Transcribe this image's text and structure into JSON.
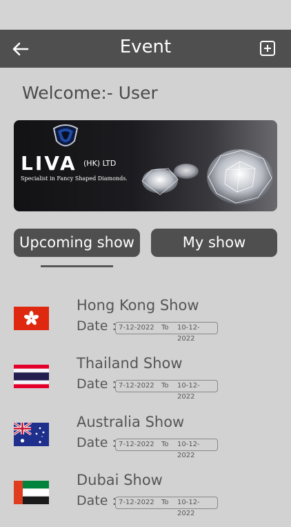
{
  "header": {
    "title": "Event",
    "back_icon": "arrow-left-icon",
    "add_icon": "plus-square-icon"
  },
  "welcome": "Welcome:- User",
  "banner": {
    "brand": "LIVA",
    "brand_suffix": "(HK) LTD",
    "tagline": "Specialist in Fancy Shaped Diamonds."
  },
  "tabs": [
    {
      "label": "Upcoming show",
      "active": true
    },
    {
      "label": "My show",
      "active": false
    }
  ],
  "shows": [
    {
      "name": "Hong Kong Show",
      "date_label": "Date :",
      "from": "7-12-2022",
      "to_label": "To",
      "to": "10-12-2022",
      "flag": "hong-kong-flag-icon"
    },
    {
      "name": "Thailand Show",
      "date_label": "Date :",
      "from": "7-12-2022",
      "to_label": "To",
      "to": "10-12-2022",
      "flag": "thailand-flag-icon"
    },
    {
      "name": "Australia Show",
      "date_label": "Date :",
      "from": "7-12-2022",
      "to_label": "To",
      "to": "10-12-2022",
      "flag": "australia-flag-icon"
    },
    {
      "name": "Dubai Show",
      "date_label": "Date :",
      "from": "7-12-2022",
      "to_label": "To",
      "to": "10-12-2022",
      "flag": "uae-flag-icon"
    }
  ],
  "colors": {
    "appbar": "#4f4f4f",
    "background": "#d2d2d2",
    "tab": "#4f4f4f"
  }
}
